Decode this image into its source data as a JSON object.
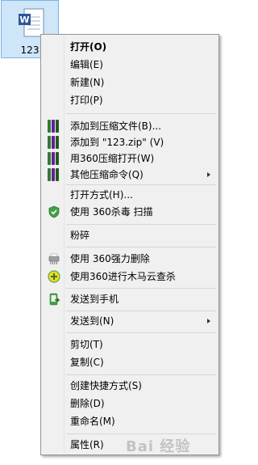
{
  "desktop": {
    "file_label": "123"
  },
  "menu": {
    "items": [
      {
        "label": "打开(O)"
      },
      {
        "label": "编辑(E)"
      },
      {
        "label": "新建(N)"
      },
      {
        "label": "打印(P)"
      },
      {
        "label": "添加到压缩文件(B)..."
      },
      {
        "label": "添加到 \"123.zip\" (V)"
      },
      {
        "label": "用360压缩打开(W)"
      },
      {
        "label": "其他压缩命令(Q)"
      },
      {
        "label": "打开方式(H)..."
      },
      {
        "label": "使用 360杀毒 扫描"
      },
      {
        "label": "粉碎"
      },
      {
        "label": "使用 360强力删除"
      },
      {
        "label": "使用360进行木马云查杀"
      },
      {
        "label": "发送到手机"
      },
      {
        "label": "发送到(N)"
      },
      {
        "label": "剪切(T)"
      },
      {
        "label": "复制(C)"
      },
      {
        "label": "创建快捷方式(S)"
      },
      {
        "label": "删除(D)"
      },
      {
        "label": "重命名(M)"
      },
      {
        "label": "属性(R)"
      }
    ]
  },
  "watermark": "Bai 经验",
  "colors": {
    "menu_bg": "#f0f0f0",
    "selection": "#cfe5f8",
    "archive_green": "#2e7d32",
    "archive_purple": "#6a1b9a"
  }
}
